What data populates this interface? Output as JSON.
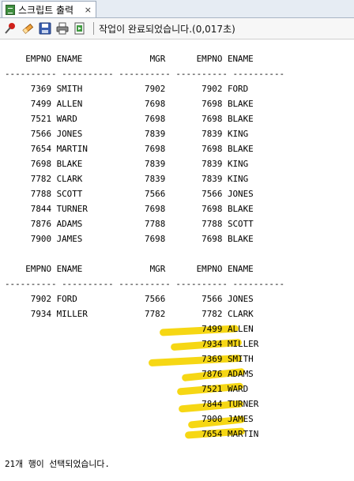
{
  "tab": {
    "title": "스크립트 출력",
    "close": "×"
  },
  "toolbar": {
    "icons": [
      "pin-icon",
      "eraser-icon",
      "save-icon",
      "print-icon",
      "export-icon"
    ],
    "status": "작업이 완료되었습니다.(0,017초)"
  },
  "output": {
    "lines": [
      "    EMPNO ENAME             MGR      EMPNO ENAME",
      "---------- ---------- ---------- ---------- ----------",
      "     7369 SMITH            7902       7902 FORD",
      "     7499 ALLEN            7698       7698 BLAKE",
      "     7521 WARD             7698       7698 BLAKE",
      "     7566 JONES            7839       7839 KING",
      "     7654 MARTIN           7698       7698 BLAKE",
      "     7698 BLAKE            7839       7839 KING",
      "     7782 CLARK            7839       7839 KING",
      "     7788 SCOTT            7566       7566 JONES",
      "     7844 TURNER           7698       7698 BLAKE",
      "     7876 ADAMS            7788       7788 SCOTT",
      "     7900 JAMES            7698       7698 BLAKE",
      "",
      "    EMPNO ENAME             MGR      EMPNO ENAME",
      "---------- ---------- ---------- ---------- ----------",
      "     7902 FORD             7566       7566 JONES",
      "     7934 MILLER           7782       7782 CLARK",
      "                                      7499 ALLEN",
      "                                      7934 MILLER",
      "                                      7369 SMITH",
      "                                      7876 ADAMS",
      "                                      7521 WARD",
      "                                      7844 TURNER",
      "                                      7900 JAMES",
      "                                      7654 MARTIN",
      "",
      "21개 행이 선택되었습니다."
    ]
  }
}
